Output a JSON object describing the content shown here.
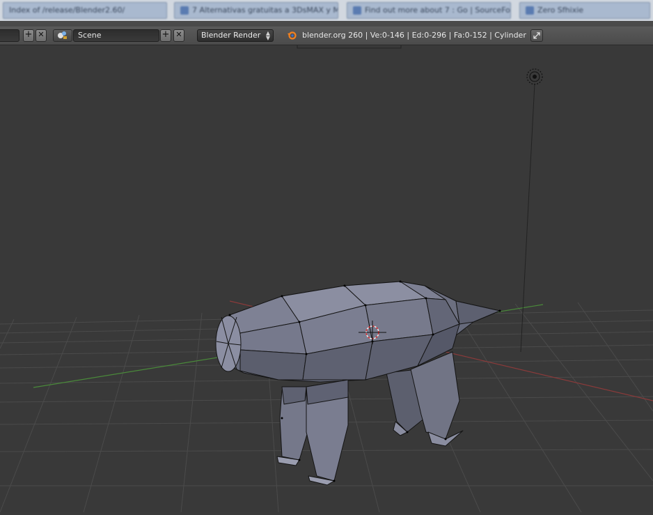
{
  "browser_tabs": [
    {
      "label": "Index of /release/Blender2.60/"
    },
    {
      "label": "7 Alternativas gratuitas a 3DsMAX y M..."
    },
    {
      "label": "Find out more about 7 : Go | SourceFo..."
    },
    {
      "label": "Zero Sfhixie"
    }
  ],
  "header": {
    "scene_label": "Scene",
    "add_symbol": "+",
    "remove_symbol": "✕",
    "render_engine": "Blender Render",
    "stats": "blender.org 260 | Ve:0-146 | Ed:0-296 | Fa:0-152 | Cylinder"
  },
  "colors": {
    "header_bg": "#4b4b4b",
    "viewport_bg": "#393939",
    "grid": "#4a4a4a",
    "axis_x": "#8a3a3a",
    "axis_y": "#3a8a3a",
    "mesh_face": "#6b6e80",
    "mesh_edge": "#1a1a1a"
  },
  "icons": [
    "add-icon",
    "remove-icon",
    "scene-icon",
    "blender-logo-icon",
    "fullscreen-icon",
    "lamp-icon",
    "3d-cursor-icon"
  ]
}
